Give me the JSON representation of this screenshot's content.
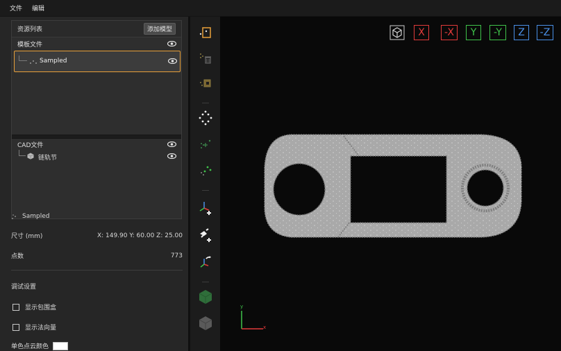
{
  "menu": {
    "file": "文件",
    "edit": "编辑"
  },
  "resources": {
    "title": "资源列表",
    "add_model_button": "添加模型",
    "template_section": "模板文件",
    "template_item": "Sampled",
    "cad_section": "CAD文件",
    "cad_item": "链轨节"
  },
  "properties": {
    "selected_name": "Sampled",
    "size_label": "尺寸 (mm)",
    "size_value": "X: 149.90 Y: 60.00 Z: 25.00",
    "points_label": "点数",
    "points_value": "773"
  },
  "debug": {
    "title": "调试设置",
    "show_bbox": "显示包围盒",
    "show_normals": "显示法向量",
    "mono_color": "单色点云颜色",
    "show_bbox_checked": false,
    "show_normals_checked": false,
    "mono_color_value": "#ffffff"
  },
  "view_buttons": {
    "x": "X",
    "neg_x": "-X",
    "y": "Y",
    "neg_y": "-Y",
    "z": "Z",
    "neg_z": "-Z"
  },
  "axis_labels": {
    "x": "x",
    "y": "y"
  },
  "colors": {
    "accent_selection": "#e8a03a",
    "axis_x": "#e23b3b",
    "axis_y": "#3fc24a",
    "axis_z": "#4a90e8",
    "part_fill": "#a9a9a9"
  }
}
